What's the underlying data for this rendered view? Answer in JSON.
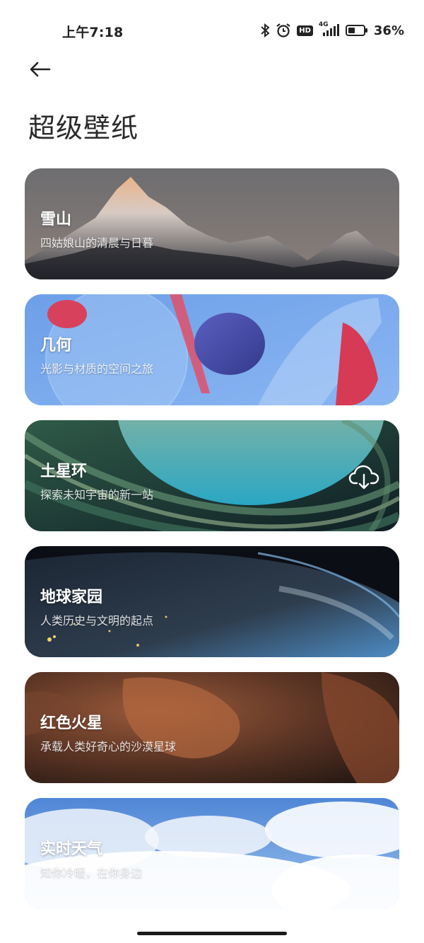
{
  "status_bar": {
    "time": "上午7:18",
    "hd_label": "HD",
    "network_label": "4G",
    "battery_percent": "36%"
  },
  "header": {
    "title": "超级壁纸"
  },
  "wallpapers": [
    {
      "title": "雪山",
      "subtitle": "四姑娘山的清晨与日暮"
    },
    {
      "title": "几何",
      "subtitle": "光影与材质的空间之旅"
    },
    {
      "title": "土星环",
      "subtitle": "探索未知宇宙的新一站",
      "download_icon": "cloud-download-icon"
    },
    {
      "title": "地球家园",
      "subtitle": "人类历史与文明的起点"
    },
    {
      "title": "红色火星",
      "subtitle": "承载人类好奇心的沙漠星球"
    },
    {
      "title": "实时天气",
      "subtitle": "知你冷暖，在你身边"
    }
  ]
}
